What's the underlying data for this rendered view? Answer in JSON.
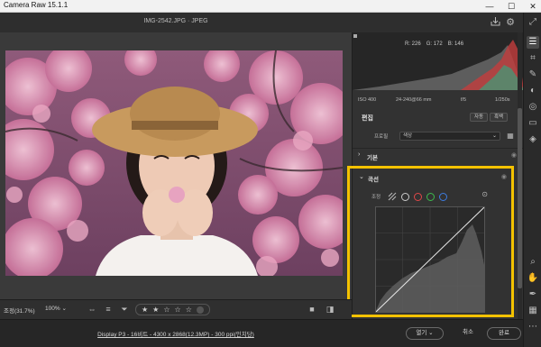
{
  "os": {
    "title": "Camera Raw 15.1.1",
    "minimize": "—",
    "maximize": "☐",
    "close": "✕"
  },
  "header": {
    "file_title": "IMG-2542.JPG  ·  JPEG",
    "save_icon": "save-icon",
    "settings_icon": "gear-icon",
    "fullscreen_icon": "expand-icon"
  },
  "histogram": {
    "r_label": "R: 226",
    "g_label": "G: 172",
    "b_label": "B: 146"
  },
  "camera_info": {
    "iso": "ISO 400",
    "lens": "24-240@66 mm",
    "aperture": "f/5",
    "shutter": "1/250s"
  },
  "edit_section": {
    "title": "편집",
    "auto_label": "자동",
    "bw_label": "흑백"
  },
  "profile": {
    "label": "프로필",
    "value": "색상"
  },
  "sections": {
    "basic": "기본",
    "curve": "곡선"
  },
  "curve": {
    "mode_label": "조정",
    "mode_colors": [
      "#cccccc",
      "#e04848",
      "#3dba4e",
      "#3d7ce0"
    ]
  },
  "bottom_bar": {
    "zoom_fit": "조정(31.7%)",
    "zoom_value": "100%",
    "zoom_chevron": "⌄"
  },
  "rating": {
    "stars": [
      "★",
      "★",
      "☆",
      "☆",
      "☆"
    ]
  },
  "footer": {
    "info": "Display P3 - 16비트 - 4300 x 2868(12.3MP) - 300 ppi(인치당)",
    "open_label": "열기",
    "cancel_label": "취소",
    "done_label": "완료"
  },
  "colors": {
    "accent": "#f4c200",
    "panel": "#323232",
    "background": "#2b2b2b"
  }
}
